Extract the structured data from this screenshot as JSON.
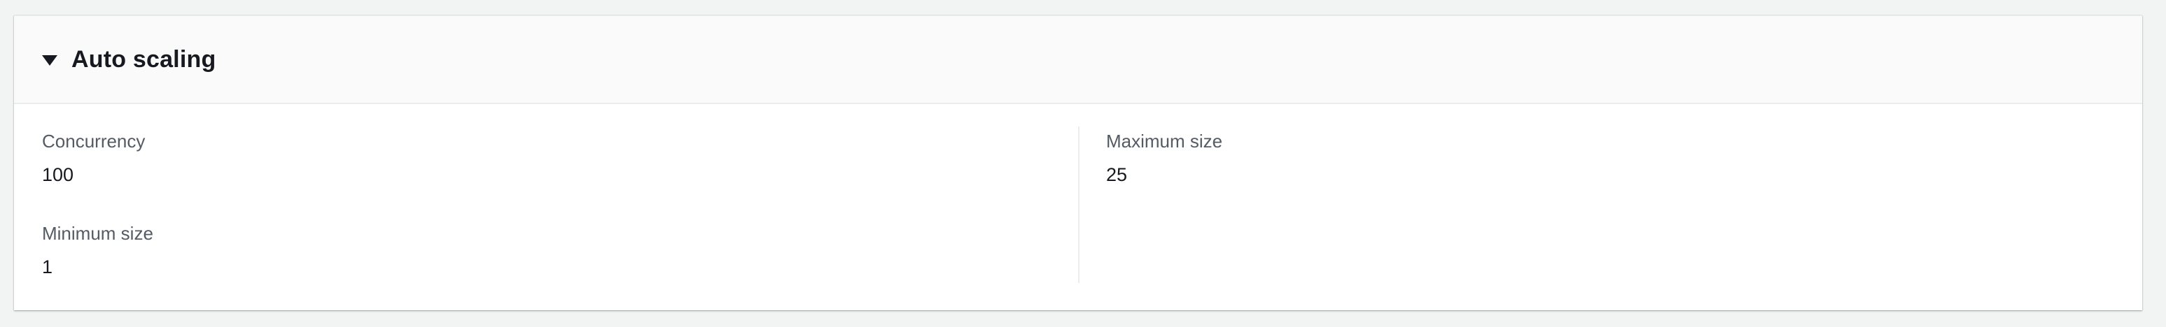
{
  "panel": {
    "title": "Auto scaling",
    "expanded": true,
    "left_column": [
      {
        "label": "Concurrency",
        "value": "100"
      },
      {
        "label": "Minimum size",
        "value": "1"
      }
    ],
    "right_column": [
      {
        "label": "Maximum size",
        "value": "25"
      }
    ]
  },
  "icons": {
    "toggle": "caret-down-icon"
  },
  "colors": {
    "page_background": "#f2f3f3",
    "header_background": "#fafafa",
    "label_text": "#545b64",
    "value_text": "#16191f"
  }
}
